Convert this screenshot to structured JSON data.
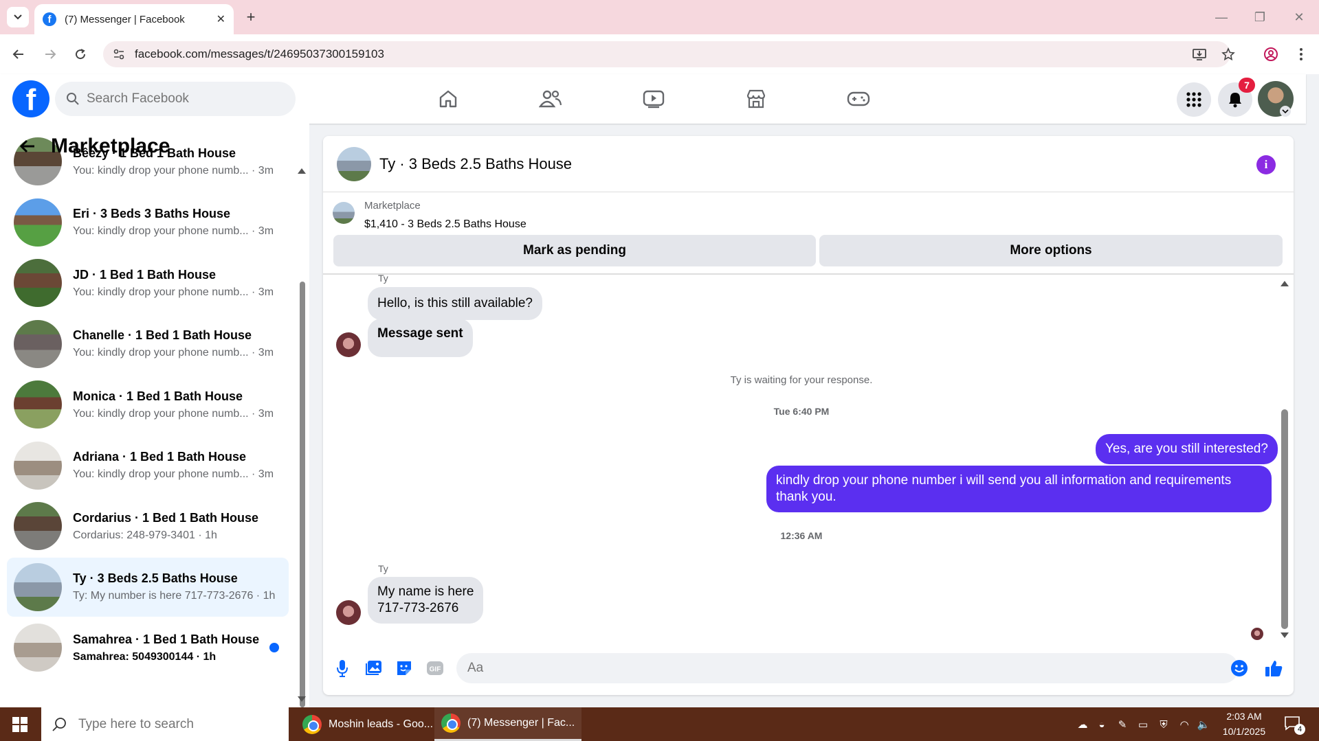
{
  "browser": {
    "tab_title": "(7) Messenger | Facebook",
    "url": "facebook.com/messages/t/24695037300159103"
  },
  "fb": {
    "search_placeholder": "Search Facebook",
    "notification_count": "7",
    "logo_letter": "f"
  },
  "sidebar": {
    "title": "Marketplace",
    "conversations": [
      {
        "name": "Bêezy · 1 Bed 1 Bath House",
        "snippet": "You: kindly drop your phone numb... · 3m",
        "unread": false,
        "active": false
      },
      {
        "name": "Eri · 3 Beds 3 Baths House",
        "snippet": "You: kindly drop your phone numb... · 3m",
        "unread": false,
        "active": false
      },
      {
        "name": "JD · 1 Bed 1 Bath House",
        "snippet": "You: kindly drop your phone numb... · 3m",
        "unread": false,
        "active": false
      },
      {
        "name": "Chanelle · 1 Bed 1 Bath House",
        "snippet": "You: kindly drop your phone numb... · 3m",
        "unread": false,
        "active": false
      },
      {
        "name": "Monica · 1 Bed 1 Bath House",
        "snippet": "You: kindly drop your phone numb... · 3m",
        "unread": false,
        "active": false
      },
      {
        "name": "Adriana · 1 Bed 1 Bath House",
        "snippet": "You: kindly drop your phone numb... · 3m",
        "unread": false,
        "active": false
      },
      {
        "name": "Cordarius · 1 Bed 1 Bath House",
        "snippet": "Cordarius: 248-979-3401 · 1h",
        "unread": false,
        "active": false
      },
      {
        "name": "Ty · 3 Beds 2.5 Baths House",
        "snippet": "Ty: My number is here 717-773-2676 · 1h",
        "unread": false,
        "active": true
      },
      {
        "name": "Samahrea · 1 Bed 1 Bath House",
        "snippet": "Samahrea: 5049300144 · 1h",
        "unread": true,
        "active": false
      }
    ]
  },
  "chat": {
    "title": "Ty · 3 Beds 2.5 Baths House",
    "listing_source": "Marketplace",
    "listing_price": "$1,410 - 3 Beds 2.5 Baths House",
    "mark_pending_label": "Mark as pending",
    "more_options_label": "More options",
    "sender_top": "Ty",
    "msg1": "Hello, is this still available?",
    "msg2": "Message sent",
    "waiting_text": "Ty is waiting for your response.",
    "time1": "Tue 6:40 PM",
    "out1": "Yes, are you still interested?",
    "out2": "kindly drop your phone number i will send you all information and requirements thank you.",
    "time2": "12:36 AM",
    "sender_bottom": "Ty",
    "msg3_line1": "My name is here",
    "msg3_line2": "717-773-2676",
    "composer_placeholder": "Aa"
  },
  "taskbar": {
    "search_placeholder": "Type here to search",
    "app1": "Moshin leads - Goo...",
    "app2": "(7) Messenger | Fac...",
    "time": "2:03 AM",
    "date": "10/1/2025",
    "notif_count": "4"
  },
  "colors": {
    "fb_blue": "#0866ff",
    "outgoing_bubble": "#5b2ff0",
    "tab_strip": "#f6d8de",
    "taskbar": "#5a2a17"
  }
}
